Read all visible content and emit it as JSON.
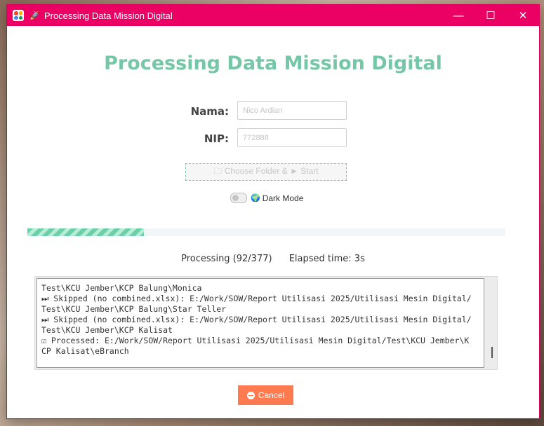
{
  "window": {
    "title": "Processing Data Mission Digital",
    "app_icon": "app-grid-icon",
    "title_icon": "rocket-icon",
    "rocket_glyph": "🚀",
    "controls": {
      "minimize": "—",
      "maximize": "☐",
      "close": "✕"
    }
  },
  "main": {
    "heading": "Processing Data Mission Digital",
    "heading_color": "#76c6a8"
  },
  "form": {
    "nama_label": "Nama:",
    "nama_placeholder": "Nico Ardian",
    "nip_label": "NIP:",
    "nip_placeholder": "772888",
    "choose_button": "🗀 Choose Folder & ► Start",
    "dark_mode_label": "Dark Mode",
    "dark_mode_on": false,
    "dark_mode_icon": "🌍"
  },
  "progress": {
    "fraction": 0.244,
    "status_text": "Processing (92/377)",
    "elapsed_text": "Elapsed time: 3s",
    "fill_color": "#6dcfa8"
  },
  "log": {
    "text": "Test\\KCU Jember\\KCP Balung\\Monica\n⏭ Skipped (no combined.xlsx): E:/Work/SOW/Report Utilisasi 2025/Utilisasi Mesin Digital/\nTest\\KCU Jember\\KCP Balung\\Star Teller\n⏭ Skipped (no combined.xlsx): E:/Work/SOW/Report Utilisasi 2025/Utilisasi Mesin Digital/\nTest\\KCU Jember\\KCP Kalisat\n☑ Processed: E:/Work/SOW/Report Utilisasi 2025/Utilisasi Mesin Digital/Test\\KCU Jember\\K\nCP Kalisat\\eBranch"
  },
  "actions": {
    "cancel_label": "Cancel",
    "cancel_color": "#ff7a4f"
  },
  "colors": {
    "titlebar": "#eb0063"
  }
}
